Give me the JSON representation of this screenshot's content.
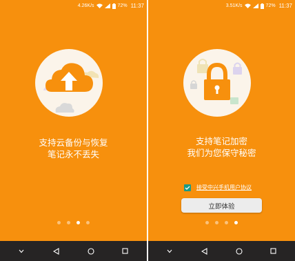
{
  "screens": [
    {
      "status": {
        "speed": "4.26K/s",
        "battery": "72%",
        "time": "11:37"
      },
      "title_line1": "支持云备份与恢复",
      "title_line2": "笔记永不丢失",
      "illustration_icon": "cloud-upload-icon",
      "page_indicator": {
        "count": 4,
        "active_index": 2
      }
    },
    {
      "status": {
        "speed": "3.51K/s",
        "battery": "72%",
        "time": "11:37"
      },
      "title_line1": "支持笔记加密",
      "title_line2": "我们为您保守秘密",
      "illustration_icon": "padlock-icon",
      "agreement_text": "接受中兴手机用户协议",
      "agreement_checked": true,
      "start_button_label": "立即体验",
      "page_indicator": {
        "count": 4,
        "active_index": 3
      }
    }
  ],
  "colors": {
    "background": "#f7900d",
    "nav_bar": "#262424",
    "checkbox": "#1b9b86",
    "button": "#ececec"
  }
}
